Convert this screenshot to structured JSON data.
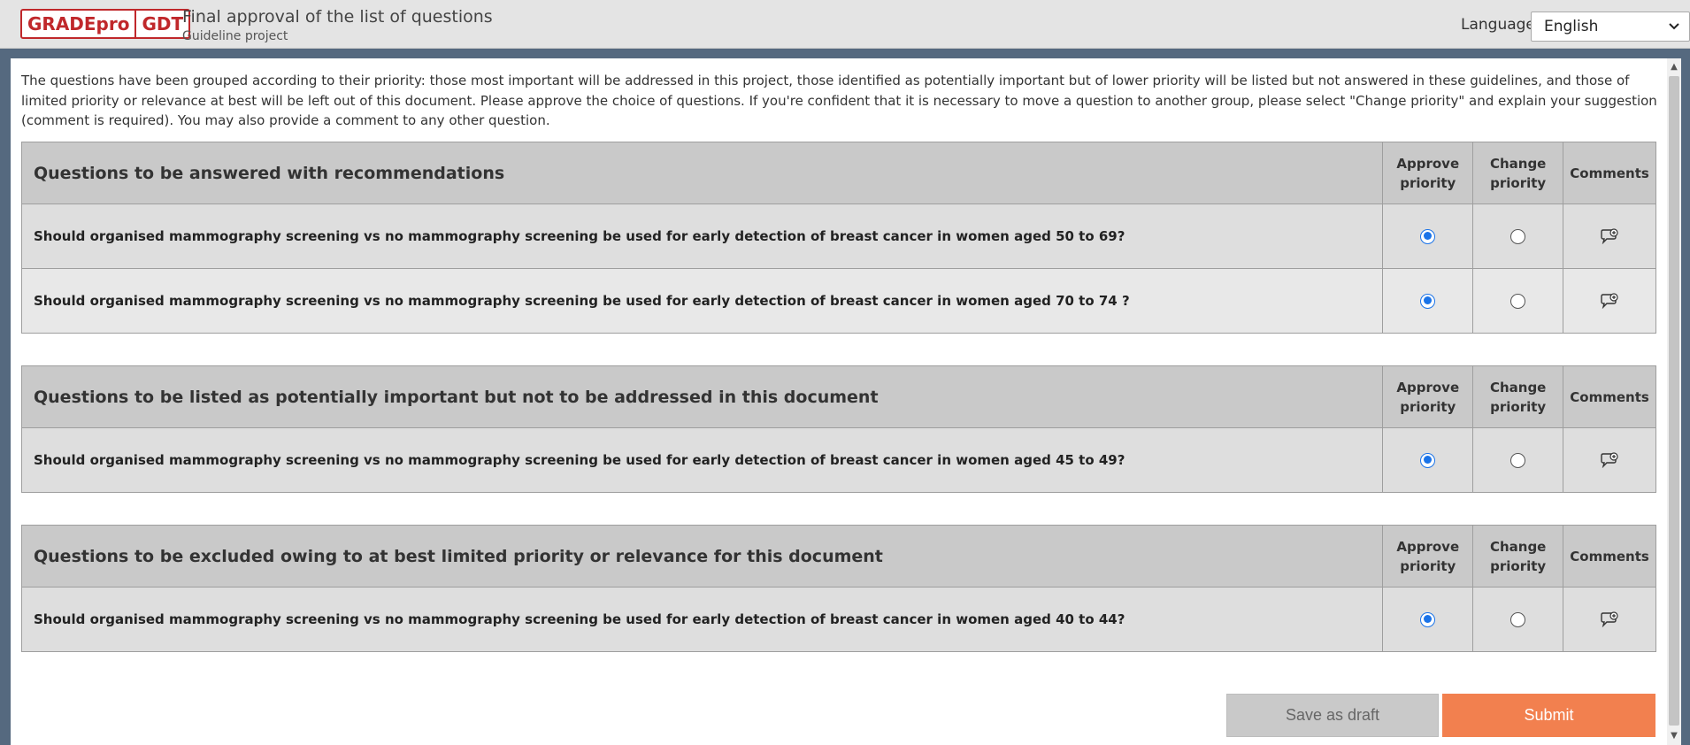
{
  "header": {
    "logo_left": "GRADEpro",
    "logo_right": "GDT",
    "title": "Final approval of the list of questions",
    "subtitle": "Guideline project",
    "language_label": "Language",
    "language_value": "English"
  },
  "intro": "The questions have been grouped according to their priority: those most important will be addressed in this project, those identified as potentially important but of lower priority will be listed but not answered in these guidelines, and those of limited priority or relevance at best will be left out of this document. Please approve the choice of questions. If you're confident that it is necessary to move a question to another group, please select \"Change priority\" and explain your suggestion (comment is required). You may also provide a comment to any other question.",
  "columns": {
    "approve": "Approve priority",
    "change": "Change priority",
    "comments": "Comments"
  },
  "groups": [
    {
      "title": "Questions to be answered with recommendations",
      "questions": [
        {
          "text": "Should organised mammography screening vs no mammography screening be used for early detection of breast cancer in women aged 50 to 69?",
          "selected": "approve"
        },
        {
          "text": "Should organised mammography screening vs no mammography screening be used for early detection of breast cancer in women aged 70 to 74 ?",
          "selected": "approve"
        }
      ]
    },
    {
      "title": "Questions to be listed as potentially important but not to be addressed in this document",
      "questions": [
        {
          "text": "Should organised mammography screening vs no mammography screening be used for early detection of breast cancer in women aged 45 to 49?",
          "selected": "approve"
        }
      ]
    },
    {
      "title": "Questions to be excluded owing to at best limited priority or relevance for this document",
      "questions": [
        {
          "text": "Should organised mammography screening vs no mammography screening be used for early detection of breast cancer in women aged 40 to 44?",
          "selected": "approve"
        }
      ]
    }
  ],
  "buttons": {
    "save_draft": "Save as draft",
    "submit": "Submit"
  },
  "colors": {
    "brand": "#c0282b",
    "submit": "#f2804f",
    "radio_selected": "#1a73e8"
  }
}
